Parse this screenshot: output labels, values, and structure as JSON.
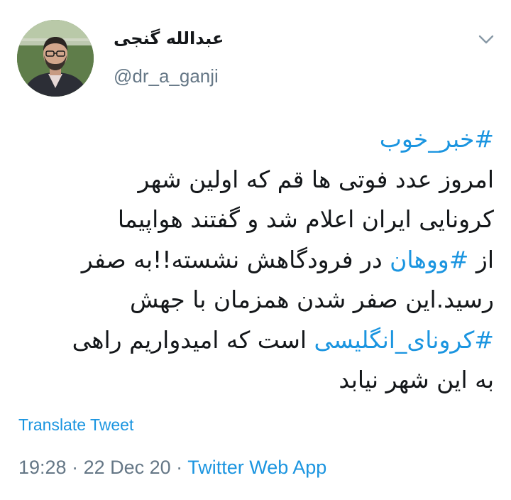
{
  "author": {
    "display_name": "عبدالله گنجی",
    "handle": "@dr_a_ganji"
  },
  "tweet": {
    "lines": [
      [
        {
          "text": "#خبر_خوب",
          "hashtag": true
        }
      ],
      [
        {
          "text": "امروز عدد فوتی ها قم که اولین شهر",
          "hashtag": false
        }
      ],
      [
        {
          "text": "کرونایی ایران اعلام شد و گفتند هواپیما",
          "hashtag": false
        }
      ],
      [
        {
          "text": "از ",
          "hashtag": false
        },
        {
          "text": "#ووهان",
          "hashtag": true
        },
        {
          "text": " در فرودگاهش نشسته!!به صفر",
          "hashtag": false
        }
      ],
      [
        {
          "text": "رسید.این صفر شدن همزمان با جهش",
          "hashtag": false
        }
      ],
      [
        {
          "text": "#کرونای_انگلیسی",
          "hashtag": true
        },
        {
          "text": " است که امیدواریم راهی",
          "hashtag": false
        }
      ],
      [
        {
          "text": "به این شهر نیابد",
          "hashtag": false
        }
      ]
    ]
  },
  "actions": {
    "translate_label": "Translate Tweet"
  },
  "meta": {
    "time": "19:28",
    "separator_1": " · ",
    "date": "22 Dec 20",
    "separator_2": " · ",
    "source": "Twitter Web App"
  },
  "icons": {
    "avatar": "profile-photo",
    "menu": "chevron-down-icon"
  },
  "colors": {
    "link": "#1b95e0",
    "secondary": "#657786",
    "text": "#14171a"
  }
}
